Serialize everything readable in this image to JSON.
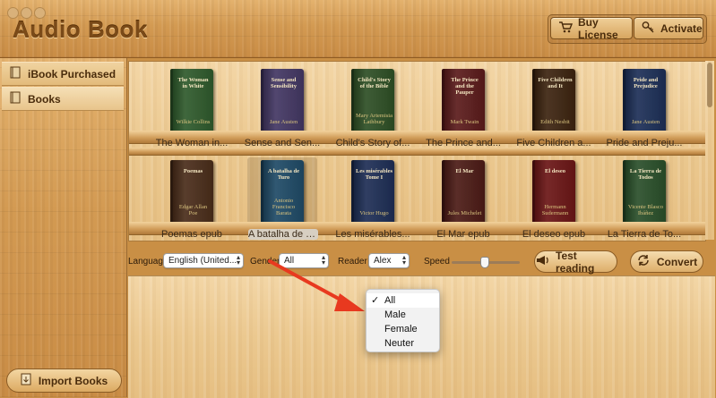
{
  "app": {
    "title": "Audio Book"
  },
  "toolbar": {
    "buy_label": "Buy License",
    "activate_label": "Activate"
  },
  "sidebar": {
    "items": [
      {
        "label": "iBook Purchased",
        "icon": "book-icon"
      },
      {
        "label": "Books",
        "icon": "book-icon"
      }
    ],
    "import_label": "Import Books"
  },
  "shelves": [
    {
      "books": [
        {
          "title": "The Woman in White",
          "author": "Wilkie Collins",
          "label": "The Woman in...",
          "color": "#2f5a2c"
        },
        {
          "title": "Sense and Sensibility",
          "author": "Jane Austen",
          "label": "Sense and Sen...",
          "color": "#433763"
        },
        {
          "title": "Child's Story of the Bible",
          "author": "Mary Artemisia Lathbury",
          "label": "Child's Story of...",
          "color": "#2e4f25"
        },
        {
          "title": "The Prince and the Pauper",
          "author": "Mark Twain",
          "label": "The Prince and...",
          "color": "#5b1b1b"
        },
        {
          "title": "Five Children and It",
          "author": "Edith Nesbit",
          "label": "Five Children a...",
          "color": "#3d2410"
        },
        {
          "title": "Pride and Prejudice",
          "author": "Jane Austen",
          "label": "Pride and Preju...",
          "color": "#1d2f57"
        }
      ]
    },
    {
      "books": [
        {
          "title": "Poemas",
          "author": "Edgar Allan Poe",
          "label": "Poemas epub",
          "color": "#4a2d1a"
        },
        {
          "title": "A batalha de Turo",
          "author": "Antonio Francisco Barata",
          "label": "A batalha de T...",
          "color": "#1f4a66"
        },
        {
          "title": "Les misérables Tome I",
          "author": "Victor Hugo",
          "label": "Les misérables...",
          "color": "#1e2e55"
        },
        {
          "title": "El Mar",
          "author": "Jules Michelet",
          "label": "El Mar epub",
          "color": "#4c1b16"
        },
        {
          "title": "El deseo",
          "author": "Hermann Sudermann",
          "label": "El deseo epub",
          "color": "#6b1616"
        },
        {
          "title": "La Tierra de Todos",
          "author": "Vicente Blasco Ibáñez",
          "label": "La Tierra de To...",
          "color": "#2a4f2a"
        }
      ]
    }
  ],
  "controls": {
    "language_label": "Language",
    "language_value": "English (United...",
    "gender_label": "Gender",
    "gender_value": "All",
    "reader_label": "Reader",
    "reader_value": "Alex",
    "speed_label": "Speed",
    "speed_level": 0.48,
    "test_label": "Test reading",
    "convert_label": "Convert"
  },
  "gender_dropdown": {
    "options": [
      "All",
      "Male",
      "Female",
      "Neuter"
    ],
    "selected": "All"
  },
  "colors": {
    "accent_red": "#e8391f"
  }
}
